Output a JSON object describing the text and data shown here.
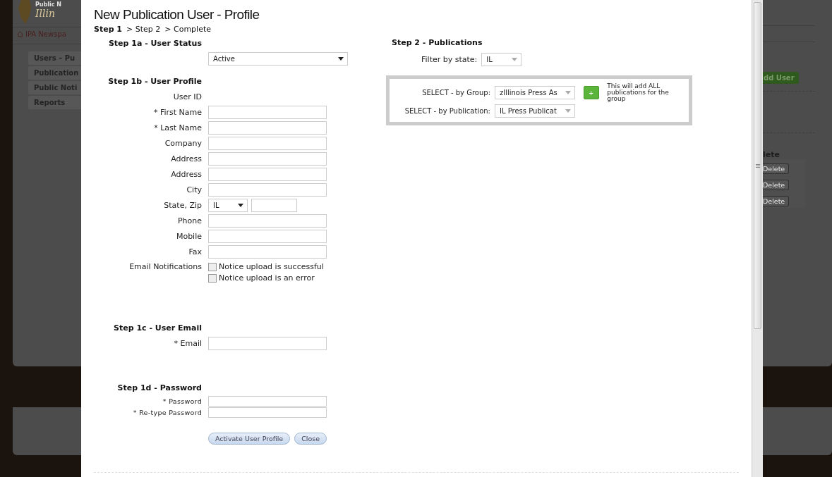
{
  "background": {
    "logo_lines": [
      "Public N",
      "Illin"
    ],
    "breadcrumb": "IPA Newspa",
    "nav": [
      "Users – Pu",
      "Publication",
      "Public Noti",
      "Reports"
    ],
    "add_user": "dd User",
    "column_heading": "lete",
    "row_buttons": [
      "Delete",
      "Delete",
      "Delete"
    ]
  },
  "dialog": {
    "title": "New Publication User - Profile",
    "steps": [
      {
        "label": "Step 1",
        "selected": true
      },
      {
        "label": "> Step 2",
        "selected": false
      },
      {
        "label": "> Complete",
        "selected": false
      }
    ],
    "user_status": {
      "heading": "Step 1a - User Status",
      "value": "Active"
    },
    "user_profile": {
      "heading": "Step 1b - User Profile",
      "fields": [
        {
          "kind": "text",
          "label": "User ID"
        },
        {
          "kind": "input",
          "label": "* First Name"
        },
        {
          "kind": "input",
          "label": "* Last Name"
        },
        {
          "kind": "input",
          "label": "Company"
        },
        {
          "kind": "input",
          "label": "Address"
        },
        {
          "kind": "input",
          "label": "Address"
        },
        {
          "kind": "input",
          "label": "City"
        },
        {
          "kind": "state_zip",
          "label": "State, Zip",
          "state": "IL"
        },
        {
          "kind": "input",
          "label": "Phone"
        },
        {
          "kind": "input",
          "label": "Mobile"
        },
        {
          "kind": "input",
          "label": "Fax"
        }
      ],
      "notifications": {
        "label": "Email Notifications",
        "options": [
          {
            "label": "Notice upload is successful",
            "checked": false
          },
          {
            "label": "Notice upload is an error",
            "checked": false
          }
        ]
      }
    },
    "user_email": {
      "heading": "Step 1c - User Email",
      "label": "* Email"
    },
    "password": {
      "heading": "Step 1d - Password",
      "fields": [
        "* Password",
        "* Re-type Password"
      ]
    },
    "buttons": [
      "Activate User Profile",
      "Close"
    ],
    "publications": {
      "heading": "Step 2 - Publications",
      "filter_label": "Filter by state:",
      "filter_value": "IL",
      "group_label": "SELECT - by Group:",
      "group_value": "zIllinois Press As",
      "add_button": "+",
      "add_hint": "This will add ALL publications for the group",
      "publication_label": "SELECT - by Publication:",
      "publication_value": "IL Press Publicat"
    }
  }
}
